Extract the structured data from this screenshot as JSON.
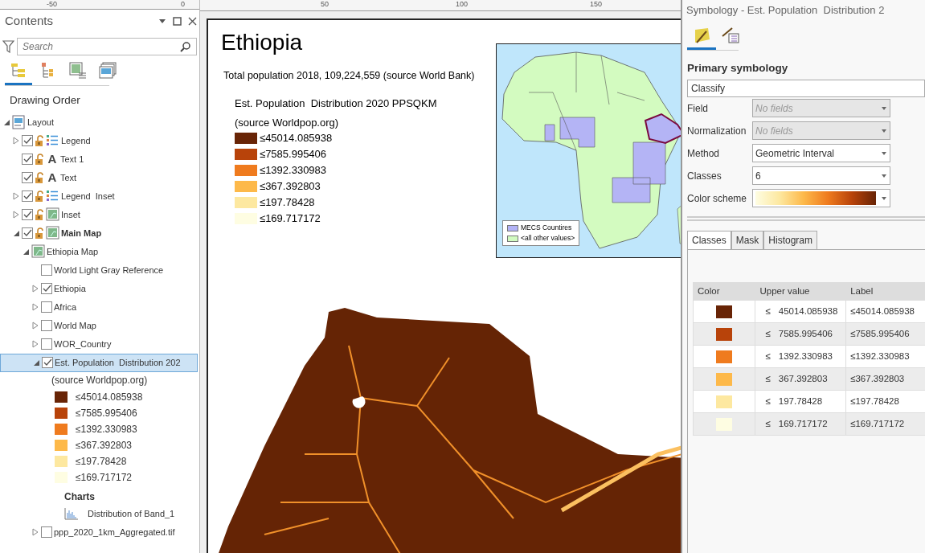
{
  "ruler": {
    "ticks": [
      "-50",
      "0",
      "50",
      "100",
      "150"
    ]
  },
  "contents": {
    "title": "Contents",
    "search": {
      "placeholder": "Search"
    },
    "view_tabs": [
      {
        "selected": true
      },
      {
        "selected": false
      },
      {
        "selected": false
      },
      {
        "selected": false
      }
    ],
    "heading": "Drawing Order",
    "tree": [
      {
        "kind": "layout",
        "label": "Layout",
        "expanded": true,
        "selected": false,
        "children": [
          {
            "kind": "legend",
            "label": "Legend",
            "checked": true,
            "expanded": false,
            "active": false,
            "selected": false
          },
          {
            "kind": "text",
            "label": "Text 1",
            "glyph": "A",
            "checked": true,
            "active": false,
            "selected": false
          },
          {
            "kind": "text",
            "label": "Text",
            "glyph": "A",
            "checked": true,
            "active": false,
            "selected": false
          },
          {
            "kind": "legend",
            "label": "Legend  Inset",
            "checked": true,
            "expanded": false,
            "active": false,
            "selected": false
          },
          {
            "kind": "mapframe",
            "label": "Inset",
            "checked": true,
            "expanded": false,
            "active": false,
            "selected": false
          },
          {
            "kind": "mapframe",
            "label": "Main Map",
            "checked": true,
            "expanded": true,
            "active": true,
            "selected": false,
            "children": [
              {
                "kind": "map",
                "label": "Ethiopia Map",
                "expanded": true,
                "selected": false,
                "children": [
                  {
                    "kind": "layer",
                    "label": "World Light Gray Reference",
                    "checked": false,
                    "selected": false
                  },
                  {
                    "kind": "layer",
                    "label": "Ethiopia",
                    "checked": true,
                    "expanded": false,
                    "selected": false
                  },
                  {
                    "kind": "layer",
                    "label": "Africa",
                    "checked": false,
                    "expanded": false,
                    "selected": false
                  },
                  {
                    "kind": "layer",
                    "label": "World Map",
                    "checked": false,
                    "expanded": false,
                    "selected": false
                  },
                  {
                    "kind": "layer",
                    "label": "WOR_Country",
                    "checked": false,
                    "expanded": false,
                    "selected": false
                  },
                  {
                    "kind": "raster",
                    "label": "Est. Population  Distribution 202",
                    "checked": true,
                    "expanded": true,
                    "selected": true,
                    "legend": {
                      "subtitle": "(source Worldpop.org)",
                      "classes": [
                        {
                          "label": "≤45014.085938",
                          "color": "#682406"
                        },
                        {
                          "label": "≤7585.995406",
                          "color": "#b8430a"
                        },
                        {
                          "label": "≤1392.330983",
                          "color": "#ef7b1e"
                        },
                        {
                          "label": "≤367.392803",
                          "color": "#fdb94a"
                        },
                        {
                          "label": "≤197.78428",
                          "color": "#fde8a0"
                        },
                        {
                          "label": "≤169.717172",
                          "color": "#fefde2"
                        }
                      ]
                    },
                    "charts": {
                      "heading": "Charts",
                      "items": [
                        "Distribution of Band_1"
                      ]
                    }
                  },
                  {
                    "kind": "layer",
                    "label": "ppp_2020_1km_Aggregated.tif",
                    "checked": false,
                    "expanded": false,
                    "selected": false
                  }
                ]
              }
            ]
          }
        ]
      }
    ]
  },
  "layout_page": {
    "title": "Ethiopia",
    "subtitle": "Total population 2018, 109,224,559 (source World Bank)",
    "legend": {
      "title": "Est. Population  Distribution 2020 PPSQKM",
      "subtitle": "(source Worldpop.org)",
      "classes": [
        {
          "label": "≤45014.085938",
          "color": "#682406"
        },
        {
          "label": "≤7585.995406",
          "color": "#b8430a"
        },
        {
          "label": "≤1392.330983",
          "color": "#ef7b1e"
        },
        {
          "label": "≤367.392803",
          "color": "#fdb94a"
        },
        {
          "label": "≤197.78428",
          "color": "#fde8a0"
        },
        {
          "label": "≤169.717172",
          "color": "#fefde2"
        }
      ]
    },
    "inset": {
      "legend": [
        {
          "label": "MECS Countires",
          "color": "#b3b3f7"
        },
        {
          "label": "<all other values>",
          "color": "#d2fbc0"
        }
      ]
    }
  },
  "symbology": {
    "title": "Symbology - Est. Population  Distribution 2",
    "tabs": [
      {
        "selected": true
      },
      {
        "selected": false
      }
    ],
    "heading": "Primary symbology",
    "renderer": "Classify",
    "fields": [
      {
        "kind": "select",
        "label": "Field",
        "value": "No fields",
        "disabled": true
      },
      {
        "kind": "select",
        "label": "Normalization",
        "value": "No fields",
        "disabled": true
      },
      {
        "kind": "select",
        "label": "Method",
        "value": "Geometric Interval",
        "disabled": false
      },
      {
        "kind": "select",
        "label": "Classes",
        "value": "6",
        "disabled": false
      },
      {
        "kind": "ramp",
        "label": "Color scheme"
      }
    ],
    "class_tabs": [
      {
        "label": "Classes",
        "selected": true
      },
      {
        "label": "Mask",
        "selected": false
      },
      {
        "label": "Histogram",
        "selected": false
      }
    ],
    "table": {
      "columns": [
        "Color",
        "Upper value",
        "Label"
      ],
      "rows": [
        {
          "color": "#682406",
          "operator": "≤",
          "upper": "45014.085938",
          "label": "≤45014.085938"
        },
        {
          "color": "#b8430a",
          "operator": "≤",
          "upper": "7585.995406",
          "label": "≤7585.995406"
        },
        {
          "color": "#ef7b1e",
          "operator": "≤",
          "upper": "1392.330983",
          "label": "≤1392.330983"
        },
        {
          "color": "#fdb94a",
          "operator": "≤",
          "upper": "367.392803",
          "label": "≤367.392803"
        },
        {
          "color": "#fde8a0",
          "operator": "≤",
          "upper": "197.78428",
          "label": "≤197.78428"
        },
        {
          "color": "#fefde2",
          "operator": "≤",
          "upper": "169.717172",
          "label": "≤169.717172"
        }
      ]
    }
  }
}
